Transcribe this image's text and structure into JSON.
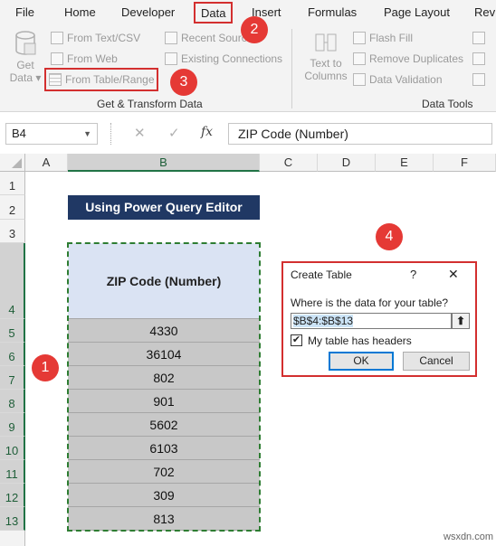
{
  "tabs": [
    "File",
    "Home",
    "Developer",
    "Data",
    "Insert",
    "Formulas",
    "Page Layout",
    "Rev"
  ],
  "ribbon": {
    "get_data": [
      "Get",
      "Data ▾"
    ],
    "from_text_csv": "From Text/CSV",
    "from_web": "From Web",
    "from_table_range": "From Table/Range",
    "recent_sources": "Recent Sources",
    "existing_connections": "Existing Connections",
    "group_get_transform": "Get & Transform Data",
    "text_to_columns": [
      "Text to",
      "Columns"
    ],
    "flash_fill": "Flash Fill",
    "remove_duplicates": "Remove Duplicates",
    "data_validation": "Data Validation",
    "group_data_tools": "Data Tools"
  },
  "formula_bar": {
    "name_box": "B4",
    "fx": "fx",
    "content": "ZIP Code (Number)"
  },
  "columns": [
    "A",
    "B",
    "C",
    "D",
    "E",
    "F"
  ],
  "rows": [
    "1",
    "2",
    "3",
    "4",
    "5",
    "6",
    "7",
    "8",
    "9",
    "10",
    "11",
    "12",
    "13"
  ],
  "sheet": {
    "title": "Using Power Query Editor",
    "header": "ZIP Code (Number)",
    "values": [
      "4330",
      "36104",
      "802",
      "901",
      "5602",
      "6103",
      "702",
      "309",
      "813"
    ]
  },
  "dialog": {
    "title": "Create Table",
    "help": "?",
    "close": "✕",
    "prompt": "Where is the data for your table?",
    "range": "$B$4:$B$13",
    "checkbox_label": "My table has headers",
    "checkbox_checked": true,
    "ok": "OK",
    "cancel": "Cancel"
  },
  "callouts": [
    "1",
    "2",
    "3",
    "4"
  ],
  "watermark": "wsxdn.com"
}
